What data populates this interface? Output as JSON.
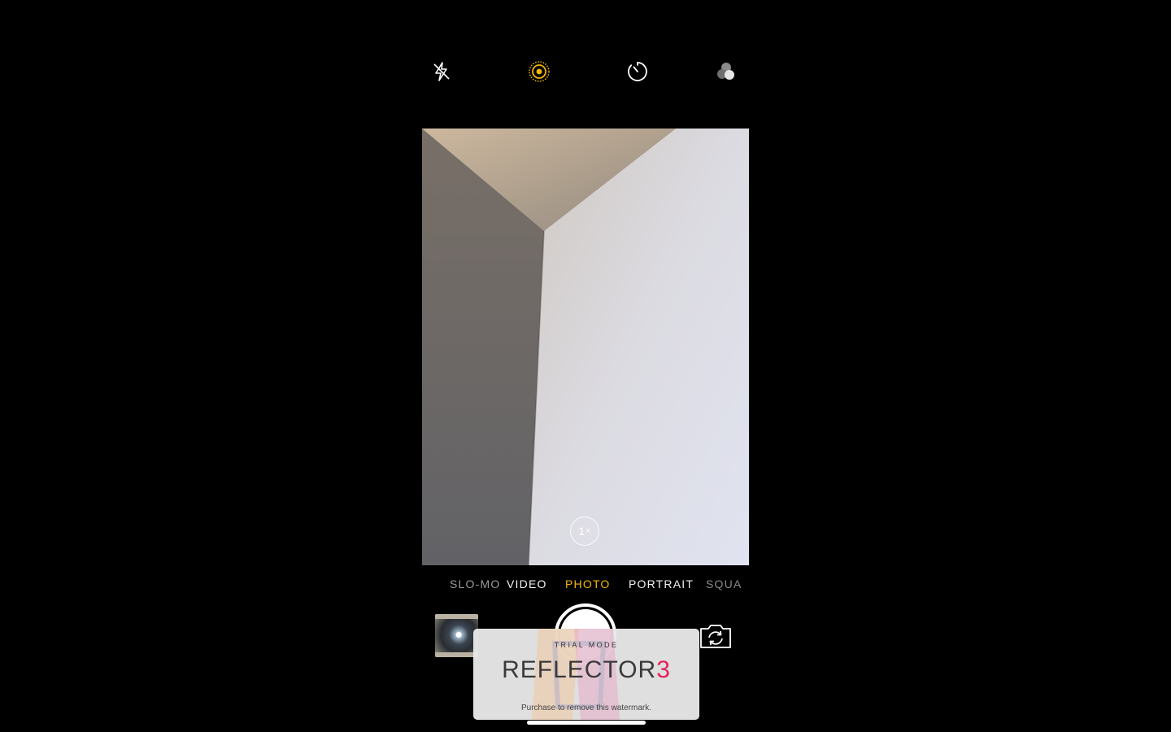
{
  "top_bar": {
    "icons": [
      "flash-off-icon",
      "live-photo-icon",
      "timer-icon",
      "filters-icon"
    ],
    "accent_color": "#f2b705"
  },
  "viewfinder": {
    "zoom_value": "1",
    "zoom_suffix": "×"
  },
  "modes": {
    "items": [
      "SLO-MO",
      "VIDEO",
      "PHOTO",
      "PORTRAIT",
      "SQUARE"
    ],
    "selected": "PHOTO"
  },
  "bottom_bar": {
    "thumbnail_icon": "last-photo-thumbnail",
    "shutter_icon": "shutter-button",
    "flip_icon": "camera-flip-icon"
  },
  "watermark": {
    "trial_label": "TRIAL MODE",
    "brand_text": "REFLECTOR",
    "brand_number": "3",
    "brand_number_color": "#e6215a",
    "purchase_text": "Purchase to remove this watermark."
  }
}
